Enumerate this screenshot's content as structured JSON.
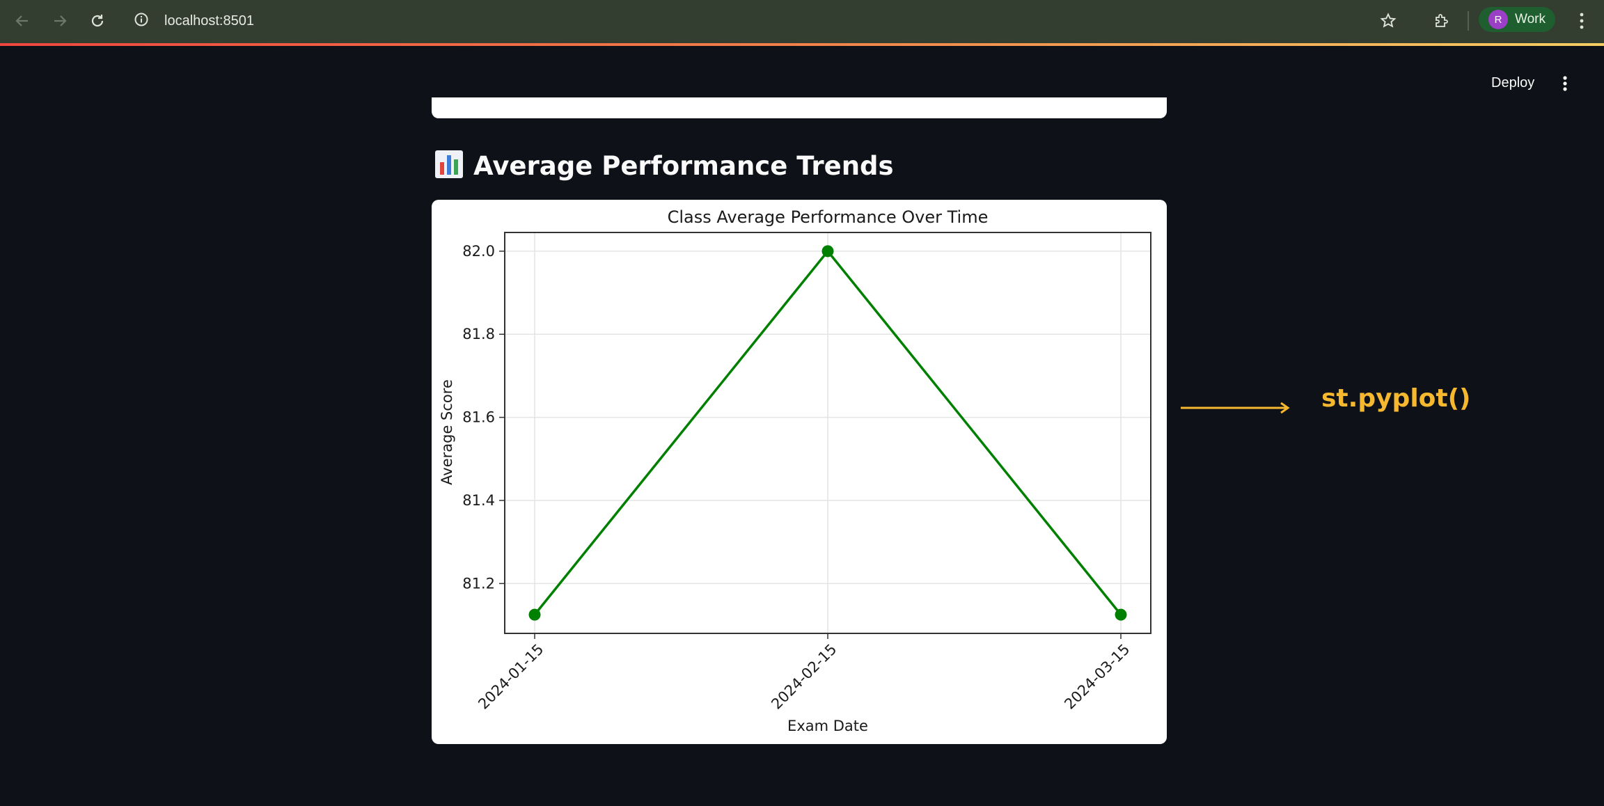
{
  "browser": {
    "url": "localhost:8501",
    "profile_initial": "R",
    "profile_label": "Work",
    "icons": [
      "back-arrow-icon",
      "forward-arrow-icon",
      "reload-icon",
      "site-info-icon",
      "star-icon",
      "extensions-icon",
      "menu-kebab-icon"
    ]
  },
  "app_header": {
    "deploy_label": "Deploy"
  },
  "section": {
    "heading_emoji": "📊",
    "heading_text": "Average Performance Trends"
  },
  "annotation": {
    "label": "st.pyplot()",
    "color": "#f5b82e"
  },
  "chart_data": {
    "type": "line",
    "title": "Class Average Performance Over Time",
    "xlabel": "Exam Date",
    "ylabel": "Average Score",
    "categories": [
      "2024-01-15",
      "2024-02-15",
      "2024-03-15"
    ],
    "values": [
      81.125,
      82.0,
      81.125
    ],
    "ylim": [
      81.08,
      82.045
    ],
    "yticks": [
      "81.2",
      "81.4",
      "81.6",
      "81.8",
      "82.0"
    ],
    "ytick_values": [
      81.2,
      81.4,
      81.6,
      81.8,
      82.0
    ],
    "line_color": "#008000",
    "grid": true,
    "x_tick_rotation": "45"
  }
}
